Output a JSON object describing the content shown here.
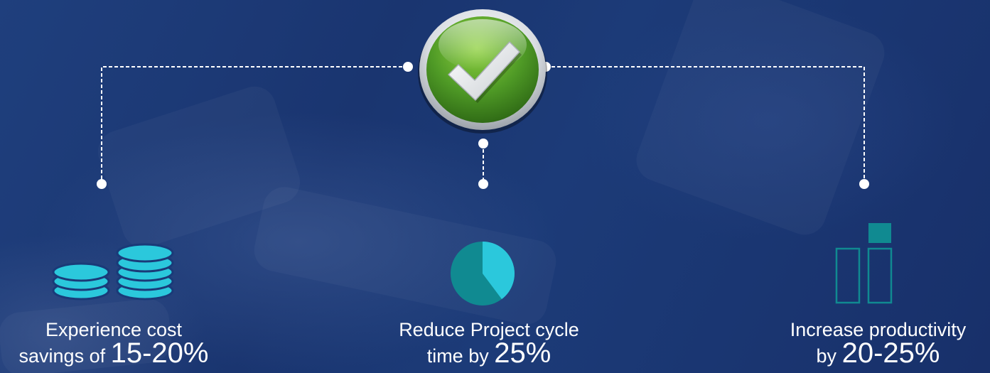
{
  "hub": {
    "icon": "checkmark-icon",
    "color": "#4f9a26"
  },
  "items": [
    {
      "icon": "coins-stack-icon",
      "line1": "Experience cost",
      "line2_prefix": "savings of",
      "value": "15-20%"
    },
    {
      "icon": "pie-chart-icon",
      "line1": "Reduce Project cycle",
      "line2_prefix": "time by",
      "value": "25%"
    },
    {
      "icon": "bar-chart-icon",
      "line1": "Increase productivity",
      "line2_prefix": "by",
      "value": "20-25%"
    }
  ],
  "colors": {
    "accent": "#2bc8dc",
    "accent_dark": "#108a91",
    "text": "#ffffff",
    "background": "#1c3a78"
  }
}
